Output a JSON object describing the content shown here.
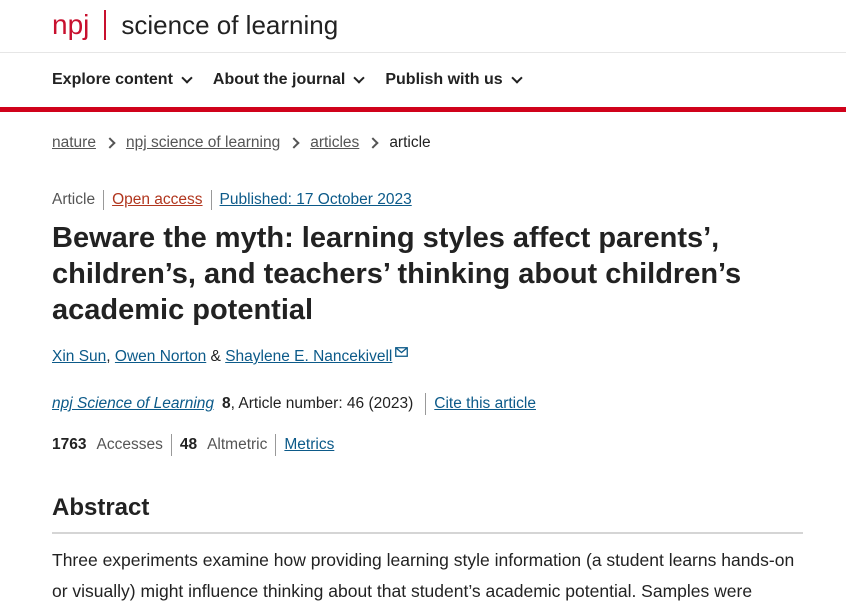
{
  "brand": {
    "journal_short": "npj",
    "journal_name": "science of learning"
  },
  "nav": {
    "items": [
      {
        "label": "Explore content"
      },
      {
        "label": "About the journal"
      },
      {
        "label": "Publish with us"
      }
    ]
  },
  "breadcrumb": {
    "items": [
      "nature",
      "npj science of learning",
      "articles"
    ],
    "current": "article"
  },
  "meta": {
    "type": "Article",
    "access": "Open access",
    "published": "Published: 17 October 2023"
  },
  "article": {
    "title": "Beware the myth: learning styles affect parents’, children’s, and teachers’ thinking about children’s academic potential",
    "authors": [
      "Xin Sun",
      "Owen Norton",
      "Shaylene E. Nancekivell"
    ],
    "author_sep_1": ", ",
    "author_sep_2": " & "
  },
  "journal": {
    "name": "npj Science of Learning",
    "volume": "8",
    "rest": ", Article number: 46 (2023)",
    "cite_label": "Cite this article"
  },
  "metrics": {
    "accesses_value": "1763",
    "accesses_label": "Accesses",
    "altmetric_value": "48",
    "altmetric_label": "Altmetric",
    "metrics_link": "Metrics"
  },
  "abstract": {
    "heading": "Abstract",
    "text": "Three experiments examine how providing learning style information (a student learns hands-on or visually) might influence thinking about that student’s academic potential. Samples were"
  },
  "icons": {
    "mail": "mail-icon",
    "chevron": "chevron-down-icon",
    "breadcrumb_separator": "chevron-right-icon"
  },
  "colors": {
    "brand_red": "#c8102e",
    "nav_rule": "#d0021b",
    "link_blue": "#0c5a89",
    "open_access": "#b1361e"
  }
}
